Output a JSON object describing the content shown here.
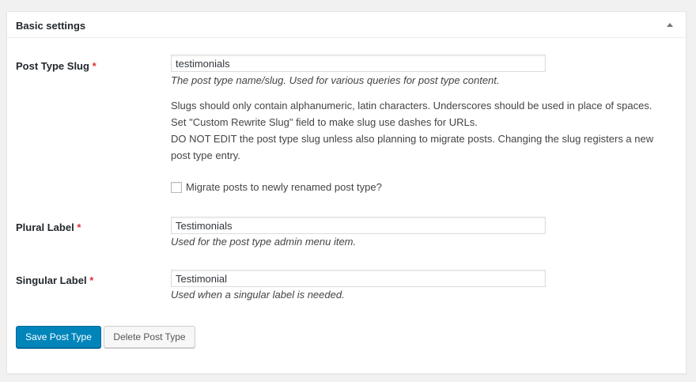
{
  "panel": {
    "title": "Basic settings"
  },
  "fields": {
    "post_type_slug": {
      "label": "Post Type Slug",
      "required_mark": "*",
      "value": "testimonials",
      "description": "The post type name/slug. Used for various queries for post type content.",
      "note1": "Slugs should only contain alphanumeric, latin characters. Underscores should be used in place of spaces. Set \"Custom Rewrite Slug\" field to make slug use dashes for URLs.",
      "note2": "DO NOT EDIT the post type slug unless also planning to migrate posts. Changing the slug registers a new post type entry.",
      "migrate_label": "Migrate posts to newly renamed post type?",
      "migrate_checked": false
    },
    "plural_label": {
      "label": "Plural Label",
      "required_mark": "*",
      "value": "Testimonials",
      "description": "Used for the post type admin menu item."
    },
    "singular_label": {
      "label": "Singular Label",
      "required_mark": "*",
      "value": "Testimonial",
      "description": "Used when a singular label is needed."
    }
  },
  "buttons": {
    "save": "Save Post Type",
    "delete": "Delete Post Type"
  },
  "colors": {
    "primary": "#0085ba",
    "required": "#dc3232"
  }
}
